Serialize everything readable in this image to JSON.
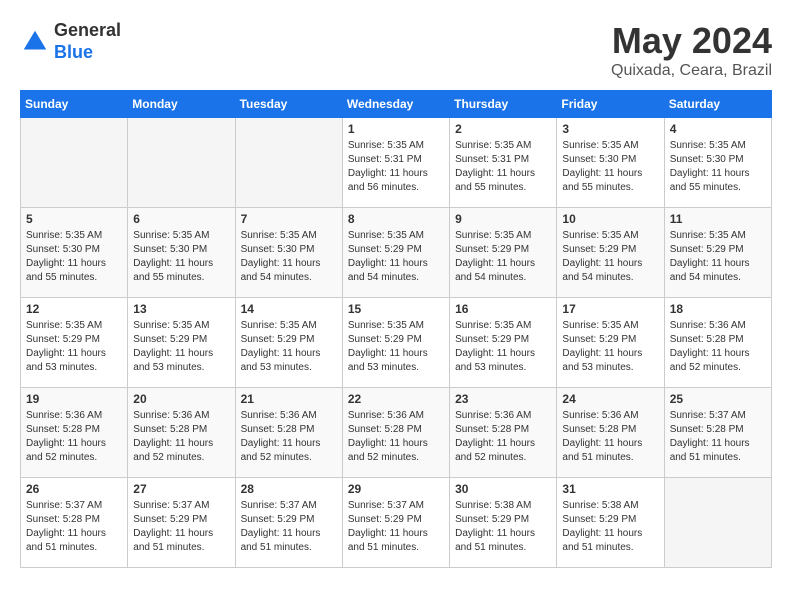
{
  "logo": {
    "general": "General",
    "blue": "Blue"
  },
  "title": {
    "month": "May 2024",
    "location": "Quixada, Ceara, Brazil"
  },
  "headers": [
    "Sunday",
    "Monday",
    "Tuesday",
    "Wednesday",
    "Thursday",
    "Friday",
    "Saturday"
  ],
  "weeks": [
    [
      {
        "day": "",
        "info": ""
      },
      {
        "day": "",
        "info": ""
      },
      {
        "day": "",
        "info": ""
      },
      {
        "day": "1",
        "info": "Sunrise: 5:35 AM\nSunset: 5:31 PM\nDaylight: 11 hours\nand 56 minutes."
      },
      {
        "day": "2",
        "info": "Sunrise: 5:35 AM\nSunset: 5:31 PM\nDaylight: 11 hours\nand 55 minutes."
      },
      {
        "day": "3",
        "info": "Sunrise: 5:35 AM\nSunset: 5:30 PM\nDaylight: 11 hours\nand 55 minutes."
      },
      {
        "day": "4",
        "info": "Sunrise: 5:35 AM\nSunset: 5:30 PM\nDaylight: 11 hours\nand 55 minutes."
      }
    ],
    [
      {
        "day": "5",
        "info": "Sunrise: 5:35 AM\nSunset: 5:30 PM\nDaylight: 11 hours\nand 55 minutes."
      },
      {
        "day": "6",
        "info": "Sunrise: 5:35 AM\nSunset: 5:30 PM\nDaylight: 11 hours\nand 55 minutes."
      },
      {
        "day": "7",
        "info": "Sunrise: 5:35 AM\nSunset: 5:30 PM\nDaylight: 11 hours\nand 54 minutes."
      },
      {
        "day": "8",
        "info": "Sunrise: 5:35 AM\nSunset: 5:29 PM\nDaylight: 11 hours\nand 54 minutes."
      },
      {
        "day": "9",
        "info": "Sunrise: 5:35 AM\nSunset: 5:29 PM\nDaylight: 11 hours\nand 54 minutes."
      },
      {
        "day": "10",
        "info": "Sunrise: 5:35 AM\nSunset: 5:29 PM\nDaylight: 11 hours\nand 54 minutes."
      },
      {
        "day": "11",
        "info": "Sunrise: 5:35 AM\nSunset: 5:29 PM\nDaylight: 11 hours\nand 54 minutes."
      }
    ],
    [
      {
        "day": "12",
        "info": "Sunrise: 5:35 AM\nSunset: 5:29 PM\nDaylight: 11 hours\nand 53 minutes."
      },
      {
        "day": "13",
        "info": "Sunrise: 5:35 AM\nSunset: 5:29 PM\nDaylight: 11 hours\nand 53 minutes."
      },
      {
        "day": "14",
        "info": "Sunrise: 5:35 AM\nSunset: 5:29 PM\nDaylight: 11 hours\nand 53 minutes."
      },
      {
        "day": "15",
        "info": "Sunrise: 5:35 AM\nSunset: 5:29 PM\nDaylight: 11 hours\nand 53 minutes."
      },
      {
        "day": "16",
        "info": "Sunrise: 5:35 AM\nSunset: 5:29 PM\nDaylight: 11 hours\nand 53 minutes."
      },
      {
        "day": "17",
        "info": "Sunrise: 5:35 AM\nSunset: 5:29 PM\nDaylight: 11 hours\nand 53 minutes."
      },
      {
        "day": "18",
        "info": "Sunrise: 5:36 AM\nSunset: 5:28 PM\nDaylight: 11 hours\nand 52 minutes."
      }
    ],
    [
      {
        "day": "19",
        "info": "Sunrise: 5:36 AM\nSunset: 5:28 PM\nDaylight: 11 hours\nand 52 minutes."
      },
      {
        "day": "20",
        "info": "Sunrise: 5:36 AM\nSunset: 5:28 PM\nDaylight: 11 hours\nand 52 minutes."
      },
      {
        "day": "21",
        "info": "Sunrise: 5:36 AM\nSunset: 5:28 PM\nDaylight: 11 hours\nand 52 minutes."
      },
      {
        "day": "22",
        "info": "Sunrise: 5:36 AM\nSunset: 5:28 PM\nDaylight: 11 hours\nand 52 minutes."
      },
      {
        "day": "23",
        "info": "Sunrise: 5:36 AM\nSunset: 5:28 PM\nDaylight: 11 hours\nand 52 minutes."
      },
      {
        "day": "24",
        "info": "Sunrise: 5:36 AM\nSunset: 5:28 PM\nDaylight: 11 hours\nand 51 minutes."
      },
      {
        "day": "25",
        "info": "Sunrise: 5:37 AM\nSunset: 5:28 PM\nDaylight: 11 hours\nand 51 minutes."
      }
    ],
    [
      {
        "day": "26",
        "info": "Sunrise: 5:37 AM\nSunset: 5:28 PM\nDaylight: 11 hours\nand 51 minutes."
      },
      {
        "day": "27",
        "info": "Sunrise: 5:37 AM\nSunset: 5:29 PM\nDaylight: 11 hours\nand 51 minutes."
      },
      {
        "day": "28",
        "info": "Sunrise: 5:37 AM\nSunset: 5:29 PM\nDaylight: 11 hours\nand 51 minutes."
      },
      {
        "day": "29",
        "info": "Sunrise: 5:37 AM\nSunset: 5:29 PM\nDaylight: 11 hours\nand 51 minutes."
      },
      {
        "day": "30",
        "info": "Sunrise: 5:38 AM\nSunset: 5:29 PM\nDaylight: 11 hours\nand 51 minutes."
      },
      {
        "day": "31",
        "info": "Sunrise: 5:38 AM\nSunset: 5:29 PM\nDaylight: 11 hours\nand 51 minutes."
      },
      {
        "day": "",
        "info": ""
      }
    ]
  ]
}
